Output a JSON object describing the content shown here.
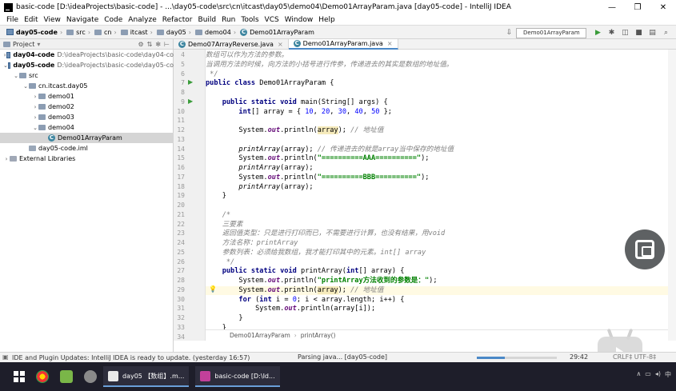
{
  "window": {
    "title": "basic-code [D:\\ideaProjects\\basic-code] - ...\\day05-code\\src\\cn\\itcast\\day05\\demo04\\Demo01ArrayParam.java [day05-code] - IntelliJ IDEA",
    "controls": [
      "—",
      "❐",
      "✕"
    ]
  },
  "menu": [
    "File",
    "Edit",
    "View",
    "Navigate",
    "Code",
    "Analyze",
    "Refactor",
    "Build",
    "Run",
    "Tools",
    "VCS",
    "Window",
    "Help"
  ],
  "navbar": {
    "crumbs": [
      "day05-code",
      "src",
      "cn",
      "itcast",
      "day05",
      "demo04",
      "Demo01ArrayParam"
    ],
    "run_config": "Demo01ArrayParam"
  },
  "project_panel": {
    "title": "Project",
    "tree": [
      {
        "label": "day04-code",
        "path": "D:\\ideaProjects\\basic-code\\day04-co",
        "arrow": "›",
        "indent": 0,
        "kind": "module",
        "bold": true
      },
      {
        "label": "day05-code",
        "path": "D:\\ideaProjects\\basic-code\\day05-co",
        "arrow": "⌄",
        "indent": 0,
        "kind": "module",
        "bold": true
      },
      {
        "label": "src",
        "path": "",
        "arrow": "⌄",
        "indent": 1,
        "kind": "folder",
        "bold": false
      },
      {
        "label": "cn.itcast.day05",
        "path": "",
        "arrow": "⌄",
        "indent": 2,
        "kind": "folder",
        "bold": false
      },
      {
        "label": "demo01",
        "path": "",
        "arrow": "›",
        "indent": 3,
        "kind": "folder",
        "bold": false
      },
      {
        "label": "demo02",
        "path": "",
        "arrow": "›",
        "indent": 3,
        "kind": "folder",
        "bold": false
      },
      {
        "label": "demo03",
        "path": "",
        "arrow": "›",
        "indent": 3,
        "kind": "folder",
        "bold": false
      },
      {
        "label": "demo04",
        "path": "",
        "arrow": "⌄",
        "indent": 3,
        "kind": "folder",
        "bold": false
      },
      {
        "label": "Demo01ArrayParam",
        "path": "",
        "arrow": "",
        "indent": 4,
        "kind": "class",
        "bold": false,
        "selected": true
      },
      {
        "label": "day05-code.iml",
        "path": "",
        "arrow": "",
        "indent": 2,
        "kind": "file",
        "bold": false
      },
      {
        "label": "External Libraries",
        "path": "",
        "arrow": "›",
        "indent": 0,
        "kind": "library",
        "bold": false
      }
    ]
  },
  "tabs": [
    {
      "label": "Demo07ArrayReverse.java",
      "active": false
    },
    {
      "label": "Demo01ArrayParam.java",
      "active": true
    }
  ],
  "editor": {
    "lines": [
      {
        "n": "4",
        "html": "<span class='doc'>数组可以作为方法的参数。</span>"
      },
      {
        "n": "5",
        "html": "<span class='doc'>当调用方法的时候，向方法的小括号进行传参，传递进去的其实是数组的地址值。</span>"
      },
      {
        "n": "6",
        "html": "<span class='doc'> */</span>"
      },
      {
        "n": "7",
        "html": "<span class='kw'>public class</span> Demo01ArrayParam {"
      },
      {
        "n": "8",
        "html": ""
      },
      {
        "n": "9",
        "html": "    <span class='kw'>public static void</span> main(String[] args) {"
      },
      {
        "n": "10",
        "html": "        <span class='kw'>int</span>[] array = { <span class='num'>10</span>, <span class='num'>20</span>, <span class='num'>30</span>, <span class='num'>40</span>, <span class='num'>50</span> };"
      },
      {
        "n": "11",
        "html": ""
      },
      {
        "n": "12",
        "html": "        System.<span class='field'>out</span>.println(<span class='highlight'>array</span>); <span class='cm'>// 地址值</span>"
      },
      {
        "n": "13",
        "html": ""
      },
      {
        "n": "14",
        "html": "        <span class='static-call'>printArray</span>(array); <span class='cm'>// 传递进去的就是array当中保存的地址值</span>"
      },
      {
        "n": "15",
        "html": "        System.<span class='field'>out</span>.println(<span class='str'>\"==========AAA==========\"</span>);"
      },
      {
        "n": "16",
        "html": "        <span class='static-call'>printArray</span>(array);"
      },
      {
        "n": "17",
        "html": "        System.<span class='field'>out</span>.println(<span class='str'>\"==========BBB==========\"</span>);"
      },
      {
        "n": "18",
        "html": "        <span class='static-call'>printArray</span>(array);"
      },
      {
        "n": "19",
        "html": "    }"
      },
      {
        "n": "20",
        "html": ""
      },
      {
        "n": "21",
        "html": "    <span class='doc'>/*</span>"
      },
      {
        "n": "22",
        "html": "    <span class='doc'>三要素</span>"
      },
      {
        "n": "23",
        "html": "    <span class='doc'>返回值类型：只是进行打印而已，不需要进行计算，也没有结果，用void</span>"
      },
      {
        "n": "24",
        "html": "    <span class='doc'>方法名称：printArray</span>"
      },
      {
        "n": "25",
        "html": "    <span class='doc'>参数列表：必须给我数组，我才能打印其中的元素。int[] array</span>"
      },
      {
        "n": "26",
        "html": "    <span class='doc'> */</span>"
      },
      {
        "n": "27",
        "html": "    <span class='kw'>public static void</span> printArray(<span class='kw'>int</span>[] array) {"
      },
      {
        "n": "28",
        "html": "        System.<span class='field'>out</span>.println(<span class='str'>\"printArray方法收到的参数是：\"</span>);"
      },
      {
        "n": "29",
        "html": "        System.<span class='field'>out</span>.println(<span class='highlight'>array</span>); <span class='cm'>// 地址值</span>"
      },
      {
        "n": "30",
        "html": "        <span class='kw'>for</span> (<span class='kw'>int</span> i = <span class='num'>0</span>; i &lt; array.length; i++) {"
      },
      {
        "n": "31",
        "html": "            System.<span class='field'>out</span>.println(array[i]);"
      },
      {
        "n": "32",
        "html": "        }"
      },
      {
        "n": "33",
        "html": "    }"
      },
      {
        "n": "34",
        "html": ""
      }
    ],
    "breadcrumb": [
      "Demo01ArrayParam",
      "printArray()"
    ]
  },
  "status": {
    "message": "IDE and Plugin Updates: IntelliJ IDEA is ready to update. (yesterday 16:57)",
    "parsing": "Parsing java... [day05-code]",
    "progress": 0.35,
    "position": "29:42",
    "encoding": "CRLF‡  UTF-8‡"
  },
  "taskbar": {
    "tasks": [
      {
        "label": "day05 【数组】.m...",
        "color": "#e9e9e9"
      },
      {
        "label": "basic-code [D:\\Id...",
        "color": "#c2409a"
      }
    ]
  },
  "colors": {
    "accent": "#4a88c7",
    "keyword": "#000080",
    "string": "#008000"
  }
}
